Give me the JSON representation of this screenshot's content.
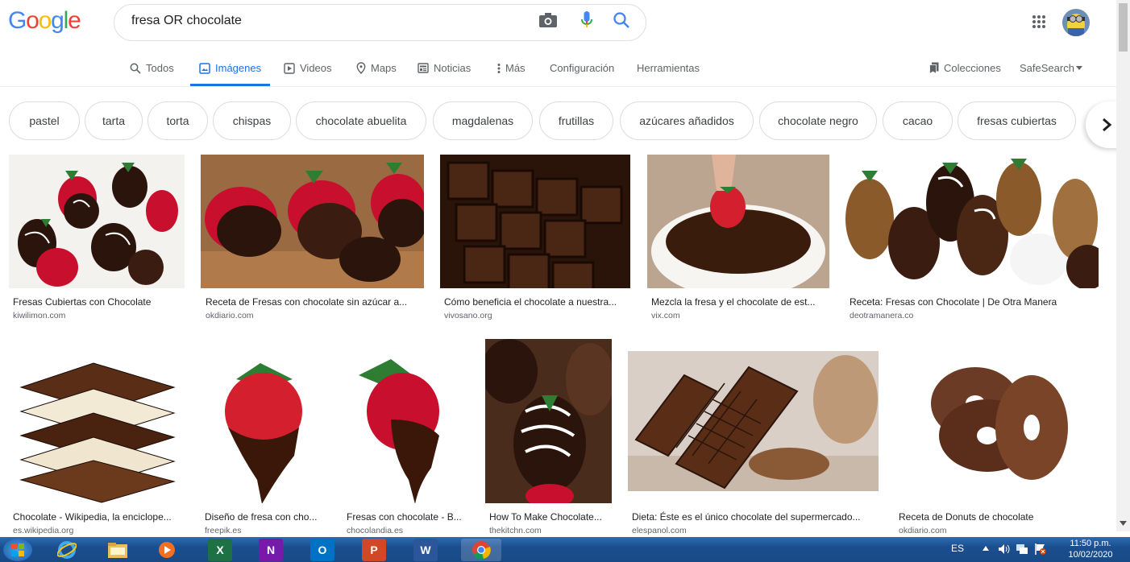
{
  "header": {
    "logo": [
      "G",
      "o",
      "o",
      "g",
      "l",
      "e"
    ],
    "logo_colors": [
      "#4285f4",
      "#ea4335",
      "#fbbc05",
      "#4285f4",
      "#34a853",
      "#ea4335"
    ],
    "query": "fresa OR chocolate",
    "icons": [
      "camera-icon",
      "microphone-icon",
      "search-icon",
      "apps-grid-icon",
      "avatar"
    ]
  },
  "tabs": {
    "todos": "Todos",
    "imagenes": "Imágenes",
    "videos": "Videos",
    "maps": "Maps",
    "noticias": "Noticias",
    "mas": "Más",
    "configuracion": "Configuración",
    "herramientas": "Herramientas",
    "colecciones": "Colecciones",
    "safesearch": "SafeSearch"
  },
  "chips": [
    "pastel",
    "tarta",
    "torta",
    "chispas",
    "chocolate abuelita",
    "magdalenas",
    "frutillas",
    "azúcares añadidos",
    "chocolate negro",
    "cacao",
    "fresas cubiertas"
  ],
  "results": [
    {
      "title": "Fresas Cubiertas con Chocolate",
      "site": "kiwilimon.com"
    },
    {
      "title": "Receta de Fresas con chocolate sin azúcar a...",
      "site": "okdiario.com"
    },
    {
      "title": "Cómo beneficia el chocolate a nuestra...",
      "site": "vivosano.org"
    },
    {
      "title": "Mezcla la fresa y el chocolate de est...",
      "site": "vix.com"
    },
    {
      "title": "Receta: Fresas con Chocolate | De Otra Manera",
      "site": "deotramanera.co"
    },
    {
      "title": "Chocolate - Wikipedia, la enciclope...",
      "site": "es.wikipedia.org"
    },
    {
      "title": "Diseño de fresa con cho...",
      "site": "freepik.es"
    },
    {
      "title": "Fresas con chocolate - B...",
      "site": "chocolandia.es"
    },
    {
      "title": "How To Make Chocolate...",
      "site": "thekitchn.com"
    },
    {
      "title": "Dieta: Éste es el único chocolate del supermercado...",
      "site": "elespanol.com"
    },
    {
      "title": "Receta de Donuts de chocolate",
      "site": "okdiario.com"
    }
  ],
  "taskbar": {
    "apps": [
      "start-orb",
      "internet-explorer",
      "file-explorer",
      "media-player",
      "excel",
      "onenote",
      "outlook",
      "powerpoint",
      "word",
      "chrome"
    ],
    "app_letters": {
      "excel": "X",
      "onenote": "N",
      "outlook": "O",
      "powerpoint": "P",
      "word": "W"
    },
    "language": "ES",
    "time": "11:50 p.m.",
    "date": "10/02/2020"
  },
  "colors": {
    "accent": "#1a73e8",
    "chocolate": "#4a2a1a",
    "strawberry": "#c8102e"
  }
}
